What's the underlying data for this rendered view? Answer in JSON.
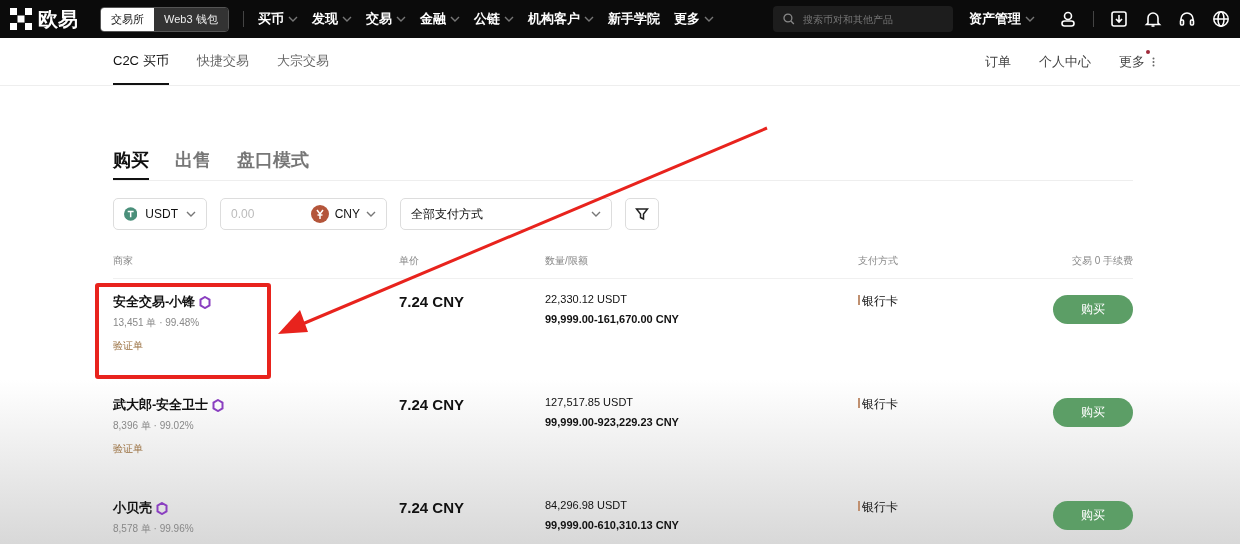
{
  "top_nav": {
    "logo": "欧易",
    "mode_tabs": [
      {
        "label": "交易所",
        "selected": true
      },
      {
        "label": "Web3 钱包",
        "selected": false
      }
    ],
    "menu": [
      {
        "label": "买币"
      },
      {
        "label": "发现"
      },
      {
        "label": "交易"
      },
      {
        "label": "金融"
      },
      {
        "label": "公链"
      },
      {
        "label": "机构客户"
      },
      {
        "label": "新手学院",
        "dropdown": false
      },
      {
        "label": "更多"
      }
    ],
    "search": {
      "placeholder": "搜索币对和其他产品"
    },
    "assets": "资产管理"
  },
  "sub_nav": {
    "tabs": [
      {
        "label": "C2C 买币",
        "selected": true
      },
      {
        "label": "快捷交易",
        "selected": false
      },
      {
        "label": "大宗交易",
        "selected": false
      }
    ],
    "links": [
      {
        "label": "订单",
        "dot": false
      },
      {
        "label": "个人中心",
        "dot": false
      },
      {
        "label": "更多",
        "dot": true
      }
    ]
  },
  "trade_tabs": [
    {
      "label": "购买",
      "selected": true
    },
    {
      "label": "出售",
      "selected": false
    },
    {
      "label": "盘口模式",
      "selected": false
    }
  ],
  "filters": {
    "crypto": "USDT",
    "amount": {
      "placeholder": "0.00"
    },
    "fiat": "CNY",
    "payment": "全部支付方式"
  },
  "table": {
    "columns": [
      "商家",
      "单价",
      "数量/限额",
      "支付方式",
      "交易 0 手续费"
    ],
    "rows": [
      {
        "merchant": "安全交易-小锋",
        "stats": "13,451 单 · 99.48%",
        "badge": "验证单",
        "price": "7.24 CNY",
        "quantity": "22,330.12 USDT",
        "limit": "99,999.00-161,670.00 CNY",
        "payment": "银行卡",
        "action": "购买",
        "highlighted": true
      },
      {
        "merchant": "武大郎-安全卫士",
        "stats": "8,396 单 · 99.02%",
        "badge": "验证单",
        "price": "7.24 CNY",
        "quantity": "127,517.85 USDT",
        "limit": "99,999.00-923,229.23 CNY",
        "payment": "银行卡",
        "action": "购买",
        "highlighted": false
      },
      {
        "merchant": "小贝壳",
        "stats": "8,578 单 · 99.96%",
        "price": "7.24 CNY",
        "quantity": "84,296.98 USDT",
        "limit": "99,999.00-610,310.13 CNY",
        "payment": "银行卡",
        "action": "购买",
        "highlighted": false
      }
    ]
  }
}
